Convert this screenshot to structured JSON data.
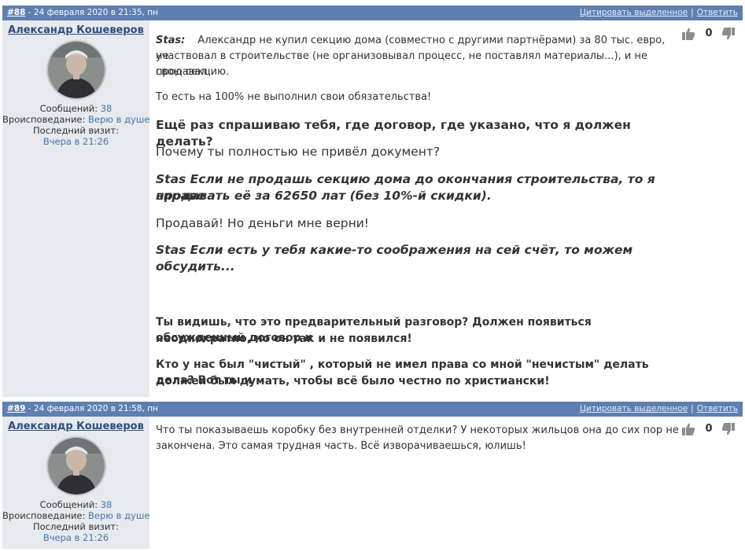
{
  "posts": [
    {
      "number": "#88",
      "date": " - 24 февраля 2020 в 21:35, пн",
      "quote_link": "Цитировать выделенное",
      "separator": "|",
      "reply_link": "Ответить",
      "author": {
        "name": "Александр Кошеверов",
        "messages_label": "Сообщений:",
        "messages_value": "38",
        "church_label": "Вроисповедание:",
        "church_value": "Верю в душе",
        "last_visit_label": "Последний визит:",
        "last_visit_value": "Вчера в 21:26"
      },
      "votes": "0",
      "lines": [
        "Stas:",
        "Александр не купил секцию дома (совместно с другими партнёрами) за 80 тыс. евро, не",
        "участвовал в строительстве (не организовывал процесс, не поставлял материалы...), и не продавал",
        "свою секцию.",
        "То есть на 100% не выполнил свои обязательства!",
        "Ещё раз спрашиваю тебя, где договор, где указано, что я должен делать?",
        "Почему ты полностью не привёл документ?",
        "Stas  Если не продашь секцию дома до окончания строительства, то я вправе",
        "продавать её за 62650 лат (без 10%-й скидки).",
        "Продавай! Но деньги мне верни!",
        "Stas    Если есть у тебя какие-то соображения на сей счёт, то можем",
        "обсудить...",
        "Ты видишь, что это предварительный разговор? Должен появиться обсужденный договор и",
        "неоднократно, но он так и не появился!",
        "Кто у нас был  \"чистый\" , который не имел права со мной \"нечистым\" делать дела? Вот ты и",
        "должен был думать, чтобы всё было честно по христиански!"
      ]
    },
    {
      "number": "#89",
      "date": " - 24 февраля 2020 в 21:58, пн",
      "quote_link": "Цитировать выделенное",
      "separator": "|",
      "reply_link": "Ответить",
      "author": {
        "name": "Александр Кошеверов",
        "messages_label": "Сообщений:",
        "messages_value": "38",
        "church_label": "Вроисповедание:",
        "church_value": "Верю в душе",
        "last_visit_label": "Последний визит:",
        "last_visit_value": "Вчера в 21:26"
      },
      "votes": "0",
      "lines": [
        "Что ты показываешь коробку без внутренней отделки? У некоторых жильцов она до сих пор не",
        "закончена. Это самая трудная часть. Всё изворачиваешься, юлишь!"
      ]
    }
  ]
}
